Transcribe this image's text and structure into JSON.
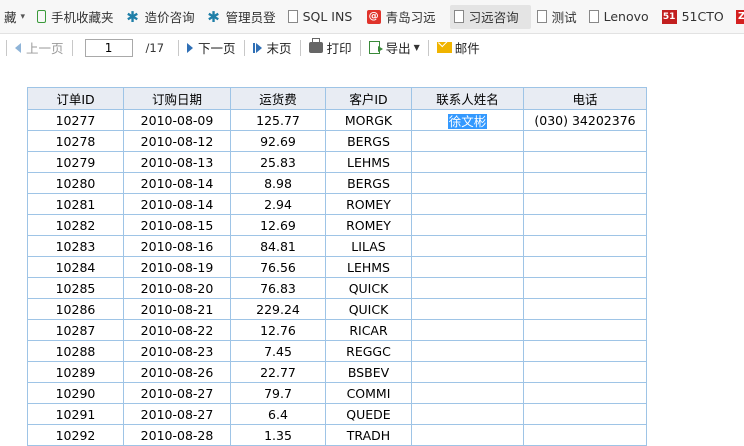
{
  "bookmarks": [
    {
      "label": "藏",
      "icon": "star-icon",
      "has_caret": true
    },
    {
      "label": "手机收藏夹",
      "icon": "phone-icon"
    },
    {
      "label": "造价咨询",
      "icon": "bookmark-star-icon"
    },
    {
      "label": "管理员登",
      "icon": "bookmark-star-icon"
    },
    {
      "label": "SQL INS",
      "icon": "page-icon"
    },
    {
      "label": "青岛习远",
      "icon": "at-icon"
    },
    {
      "label": "习远咨询",
      "icon": "page-icon",
      "active": true
    },
    {
      "label": "测试",
      "icon": "page-icon"
    },
    {
      "label": "Lenovo",
      "icon": "page-icon"
    },
    {
      "label": "51CTO",
      "icon": "51cto-icon"
    },
    {
      "label": "Z",
      "icon": "z-icon"
    }
  ],
  "toolbar": {
    "prev_label": "上一页",
    "page_value": "1",
    "page_total": "/17",
    "next_label": "下一页",
    "last_label": "末页",
    "print_label": "打印",
    "export_label": "导出",
    "mail_label": "邮件"
  },
  "table": {
    "headers": [
      "订单ID",
      "订购日期",
      "运货费",
      "客户ID",
      "联系人姓名",
      "电话"
    ],
    "rows": [
      [
        "10277",
        "2010-08-09",
        "125.77",
        "MORGK",
        "徐文彬",
        "(030) 34202376"
      ],
      [
        "10278",
        "2010-08-12",
        "92.69",
        "BERGS",
        "",
        ""
      ],
      [
        "10279",
        "2010-08-13",
        "25.83",
        "LEHMS",
        "",
        ""
      ],
      [
        "10280",
        "2010-08-14",
        "8.98",
        "BERGS",
        "",
        ""
      ],
      [
        "10281",
        "2010-08-14",
        "2.94",
        "ROMEY",
        "",
        ""
      ],
      [
        "10282",
        "2010-08-15",
        "12.69",
        "ROMEY",
        "",
        ""
      ],
      [
        "10283",
        "2010-08-16",
        "84.81",
        "LILAS",
        "",
        ""
      ],
      [
        "10284",
        "2010-08-19",
        "76.56",
        "LEHMS",
        "",
        ""
      ],
      [
        "10285",
        "2010-08-20",
        "76.83",
        "QUICK",
        "",
        ""
      ],
      [
        "10286",
        "2010-08-21",
        "229.24",
        "QUICK",
        "",
        ""
      ],
      [
        "10287",
        "2010-08-22",
        "12.76",
        "RICAR",
        "",
        ""
      ],
      [
        "10288",
        "2010-08-23",
        "7.45",
        "REGGC",
        "",
        ""
      ],
      [
        "10289",
        "2010-08-26",
        "22.77",
        "BSBEV",
        "",
        ""
      ],
      [
        "10290",
        "2010-08-27",
        "79.7",
        "COMMI",
        "",
        ""
      ],
      [
        "10291",
        "2010-08-27",
        "6.4",
        "QUEDE",
        "",
        ""
      ],
      [
        "10292",
        "2010-08-28",
        "1.35",
        "TRADH",
        "",
        ""
      ]
    ],
    "selected_cell": {
      "row": 0,
      "col": 4
    }
  }
}
